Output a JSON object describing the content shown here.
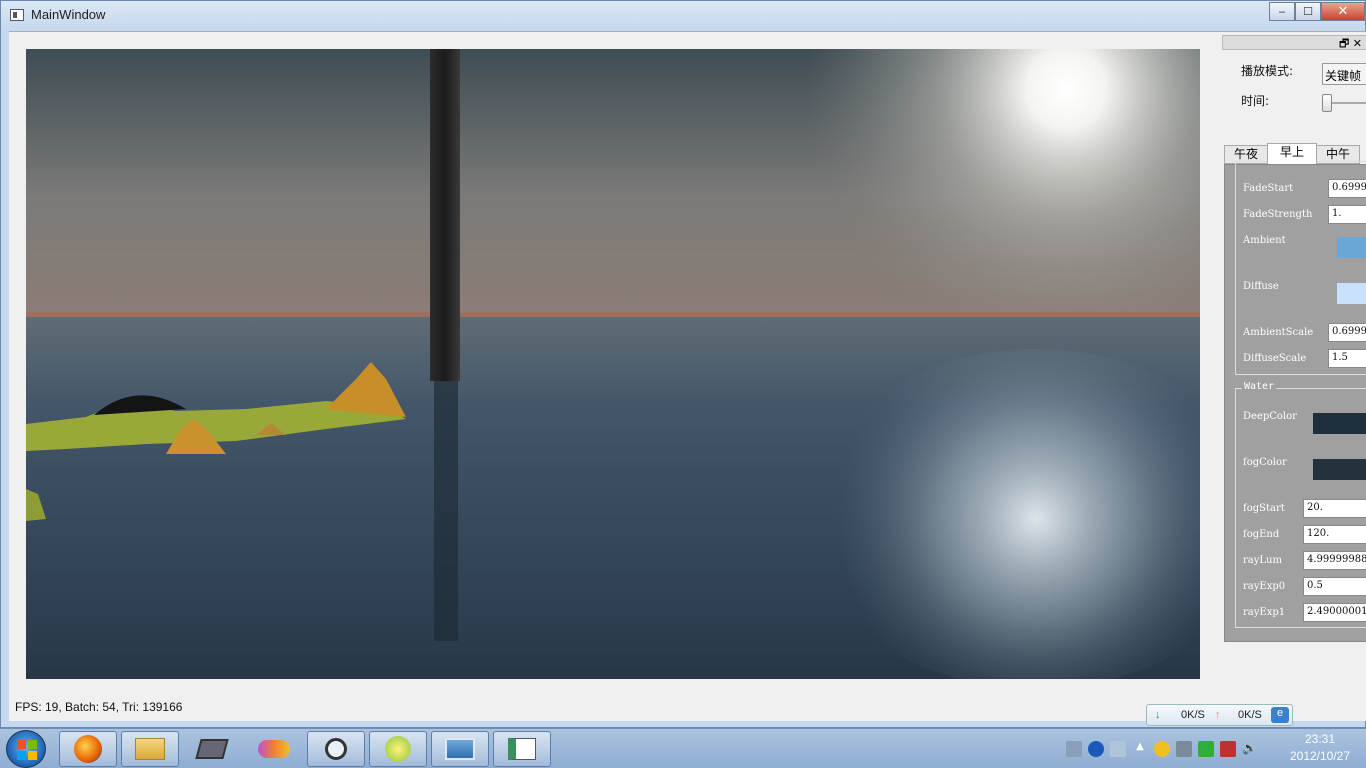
{
  "window": {
    "title": "MainWindow",
    "minimize": "‒",
    "maximize": "☐",
    "close": "✕"
  },
  "status": {
    "text": "FPS: 19, Batch: 54, Tri: 139166"
  },
  "dock": {
    "float_btn": "🗗 ✕",
    "play_mode_label": "播放模式:",
    "play_mode_value": "关键帧",
    "time_label": "时间:",
    "time_value": 0,
    "tabs": [
      "午夜",
      "早上",
      "中午"
    ],
    "active_tab": "早上",
    "sky": {
      "fade_start_label": "FadeStart",
      "fade_start": "0.6999",
      "fade_strength_label": "FadeStrength",
      "fade_strength": "1.",
      "ambient_label": "Ambient",
      "ambient_color": "#6aa6d6",
      "diffuse_label": "Diffuse",
      "diffuse_color": "#c9e0fa",
      "ambient_scale_label": "AmbientScale",
      "ambient_scale": "0.6999",
      "diffuse_scale_label": "DiffuseScale",
      "diffuse_scale": "1.5"
    },
    "water": {
      "title": "Water",
      "deep_color_label": "DeepColor",
      "deep_color": "#1f2f3b",
      "fog_color_label": "fogColor",
      "fog_color": "#24323d",
      "fog_start_label": "fogStart",
      "fog_start": "20.",
      "fog_end_label": "fogEnd",
      "fog_end": "120.",
      "ray_lum_label": "rayLum",
      "ray_lum": "4.99999988",
      "ray_exp0_label": "rayExp0",
      "ray_exp0": "0.5",
      "ray_exp1_label": "rayExp1",
      "ray_exp1": "2.49000001"
    }
  },
  "netmon": {
    "down": "0K/S",
    "up": "0K/S"
  },
  "clock": {
    "time": "23:31",
    "date": "2012/10/27"
  }
}
